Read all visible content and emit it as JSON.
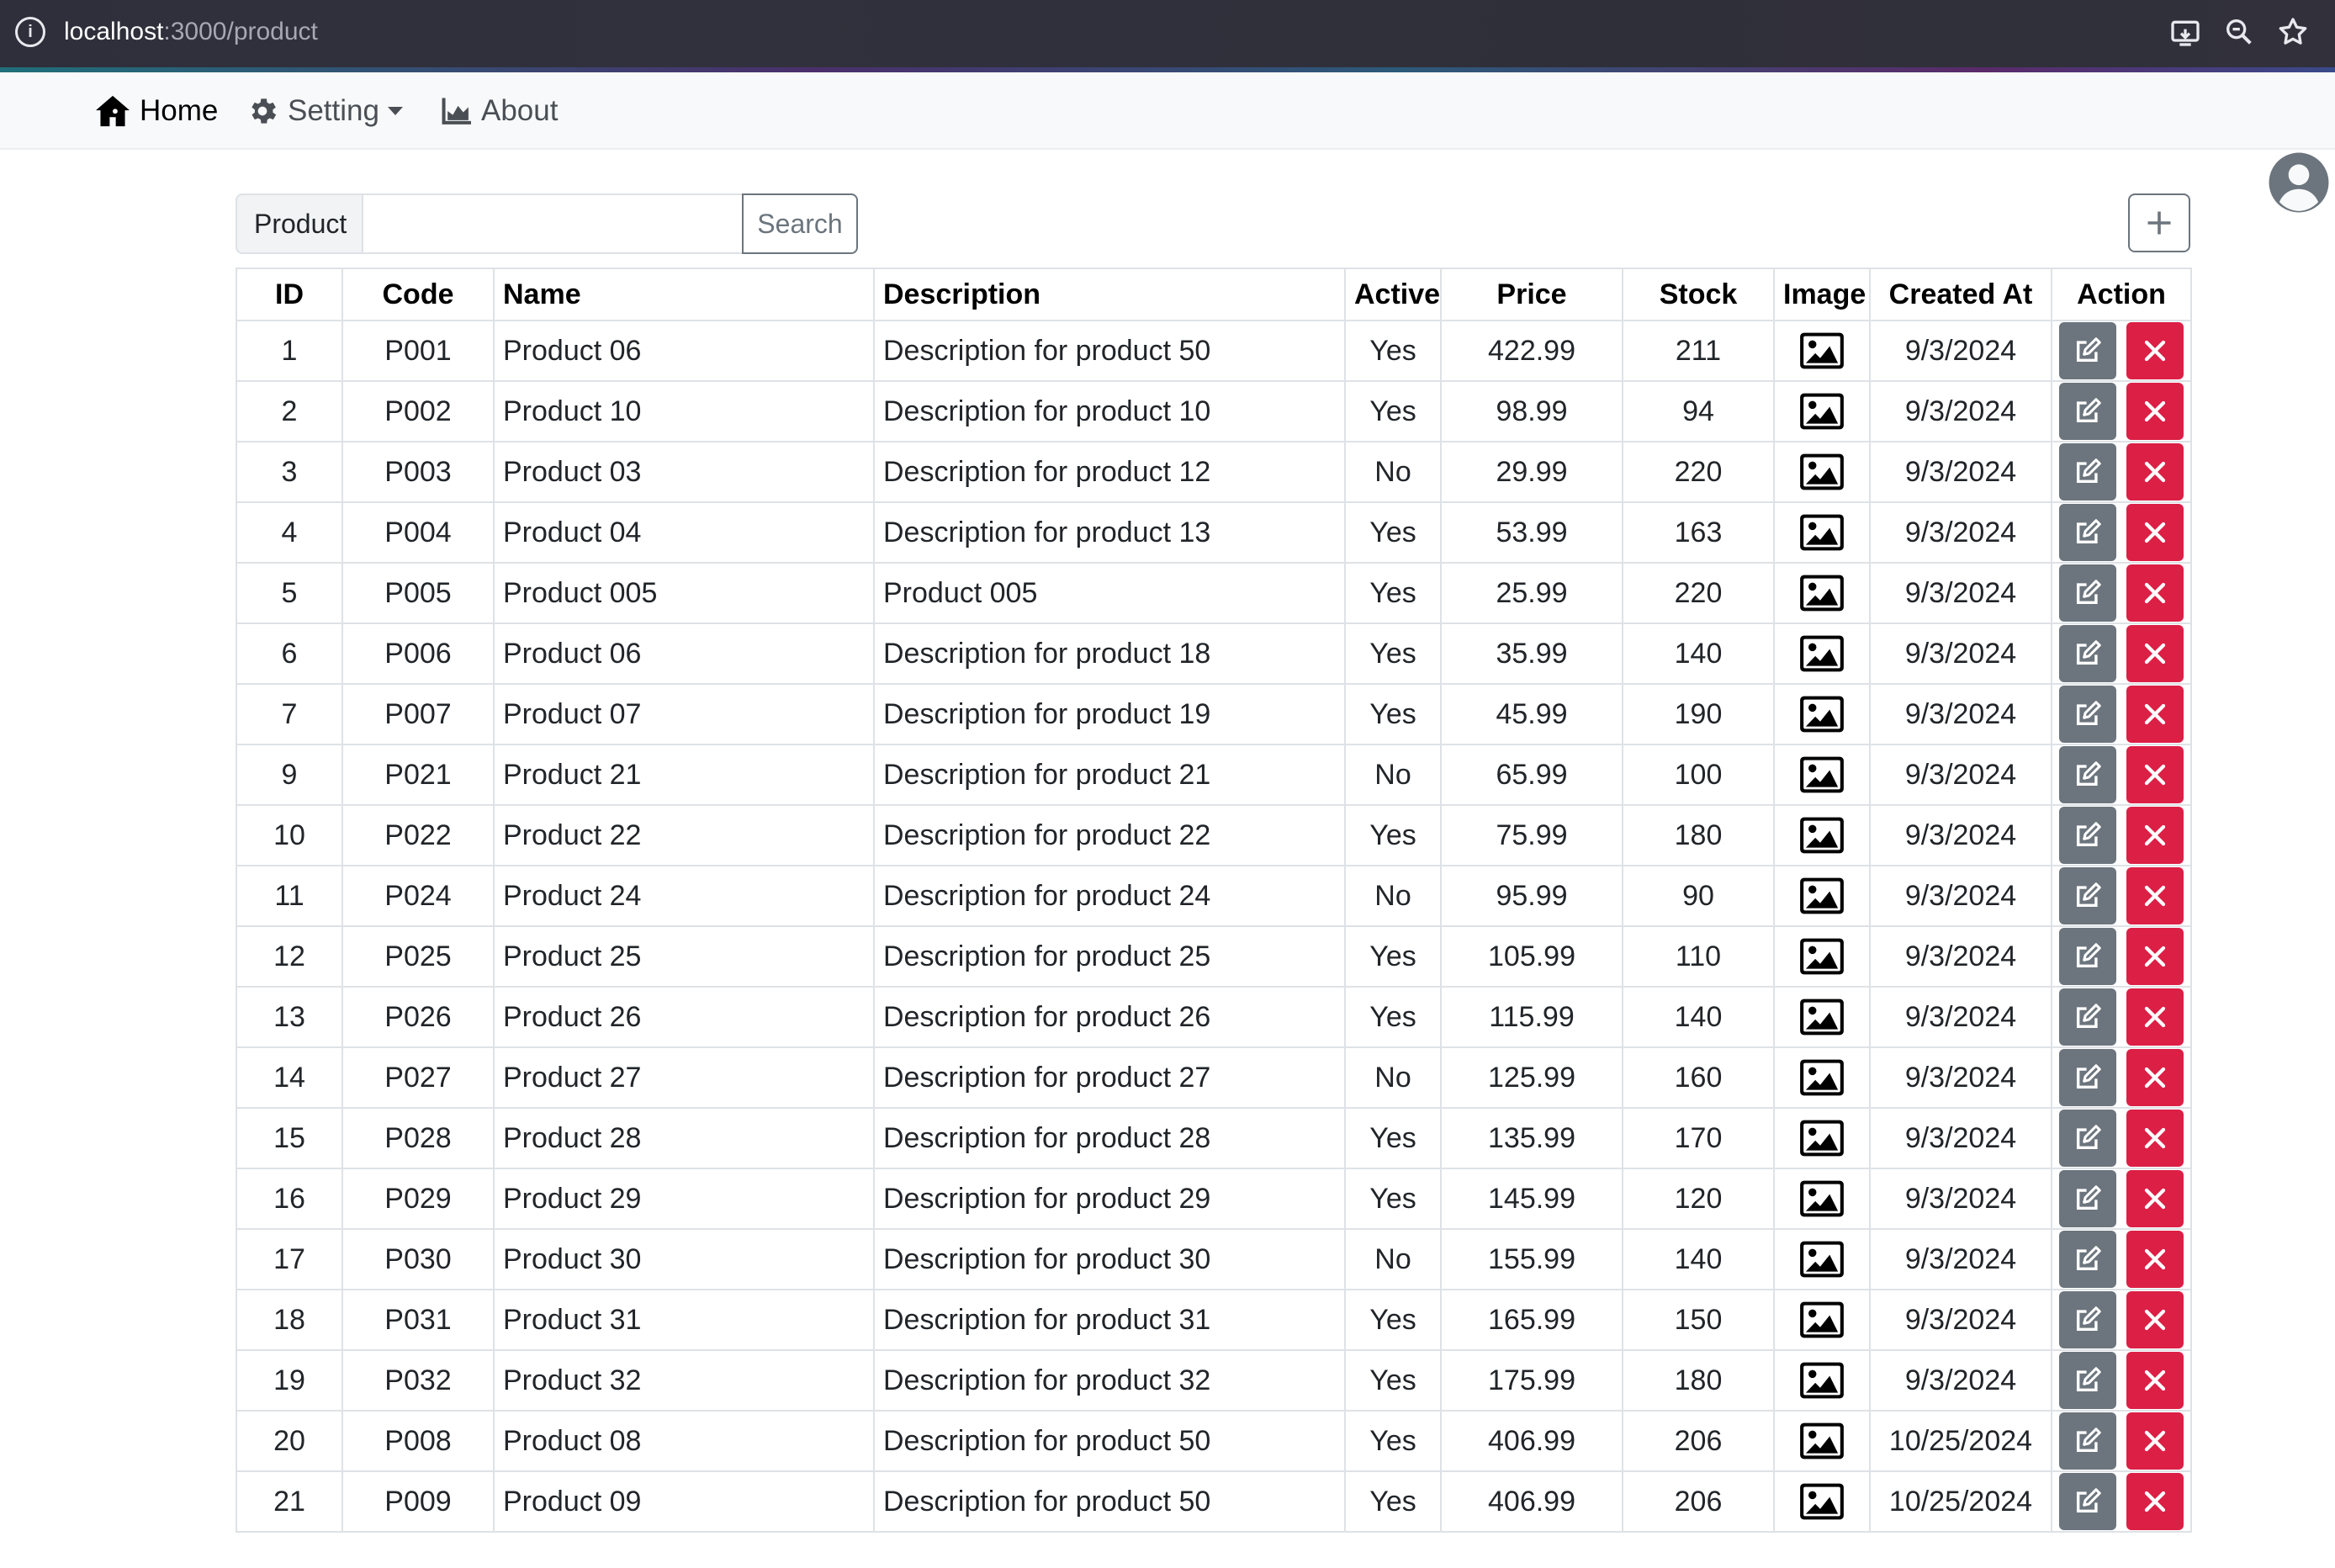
{
  "browser": {
    "url_host": "localhost",
    "url_path": ":3000/product"
  },
  "navbar": {
    "home_label": "Home",
    "setting_label": "Setting",
    "about_label": "About"
  },
  "search": {
    "label": "Product",
    "value": "",
    "button_label": "Search"
  },
  "table": {
    "headers": {
      "id": "ID",
      "code": "Code",
      "name": "Name",
      "description": "Description",
      "active": "Active",
      "price": "Price",
      "stock": "Stock",
      "image": "Image",
      "created_at": "Created At",
      "action": "Action"
    },
    "rows": [
      {
        "id": "1",
        "code": "P001",
        "name": "Product 06",
        "description": "Description for product 50",
        "active": "Yes",
        "price": "422.99",
        "stock": "211",
        "created_at": "9/3/2024"
      },
      {
        "id": "2",
        "code": "P002",
        "name": "Product 10",
        "description": "Description for product 10",
        "active": "Yes",
        "price": "98.99",
        "stock": "94",
        "created_at": "9/3/2024"
      },
      {
        "id": "3",
        "code": "P003",
        "name": "Product 03",
        "description": "Description for product 12",
        "active": "No",
        "price": "29.99",
        "stock": "220",
        "created_at": "9/3/2024"
      },
      {
        "id": "4",
        "code": "P004",
        "name": "Product 04",
        "description": "Description for product 13",
        "active": "Yes",
        "price": "53.99",
        "stock": "163",
        "created_at": "9/3/2024"
      },
      {
        "id": "5",
        "code": "P005",
        "name": "Product 005",
        "description": "Product 005",
        "active": "Yes",
        "price": "25.99",
        "stock": "220",
        "created_at": "9/3/2024"
      },
      {
        "id": "6",
        "code": "P006",
        "name": "Product 06",
        "description": "Description for product 18",
        "active": "Yes",
        "price": "35.99",
        "stock": "140",
        "created_at": "9/3/2024"
      },
      {
        "id": "7",
        "code": "P007",
        "name": "Product 07",
        "description": "Description for product 19",
        "active": "Yes",
        "price": "45.99",
        "stock": "190",
        "created_at": "9/3/2024"
      },
      {
        "id": "9",
        "code": "P021",
        "name": "Product 21",
        "description": "Description for product 21",
        "active": "No",
        "price": "65.99",
        "stock": "100",
        "created_at": "9/3/2024"
      },
      {
        "id": "10",
        "code": "P022",
        "name": "Product 22",
        "description": "Description for product 22",
        "active": "Yes",
        "price": "75.99",
        "stock": "180",
        "created_at": "9/3/2024"
      },
      {
        "id": "11",
        "code": "P024",
        "name": "Product 24",
        "description": "Description for product 24",
        "active": "No",
        "price": "95.99",
        "stock": "90",
        "created_at": "9/3/2024"
      },
      {
        "id": "12",
        "code": "P025",
        "name": "Product 25",
        "description": "Description for product 25",
        "active": "Yes",
        "price": "105.99",
        "stock": "110",
        "created_at": "9/3/2024"
      },
      {
        "id": "13",
        "code": "P026",
        "name": "Product 26",
        "description": "Description for product 26",
        "active": "Yes",
        "price": "115.99",
        "stock": "140",
        "created_at": "9/3/2024"
      },
      {
        "id": "14",
        "code": "P027",
        "name": "Product 27",
        "description": "Description for product 27",
        "active": "No",
        "price": "125.99",
        "stock": "160",
        "created_at": "9/3/2024"
      },
      {
        "id": "15",
        "code": "P028",
        "name": "Product 28",
        "description": "Description for product 28",
        "active": "Yes",
        "price": "135.99",
        "stock": "170",
        "created_at": "9/3/2024"
      },
      {
        "id": "16",
        "code": "P029",
        "name": "Product 29",
        "description": "Description for product 29",
        "active": "Yes",
        "price": "145.99",
        "stock": "120",
        "created_at": "9/3/2024"
      },
      {
        "id": "17",
        "code": "P030",
        "name": "Product 30",
        "description": "Description for product 30",
        "active": "No",
        "price": "155.99",
        "stock": "140",
        "created_at": "9/3/2024"
      },
      {
        "id": "18",
        "code": "P031",
        "name": "Product 31",
        "description": "Description for product 31",
        "active": "Yes",
        "price": "165.99",
        "stock": "150",
        "created_at": "9/3/2024"
      },
      {
        "id": "19",
        "code": "P032",
        "name": "Product 32",
        "description": "Description for product 32",
        "active": "Yes",
        "price": "175.99",
        "stock": "180",
        "created_at": "9/3/2024"
      },
      {
        "id": "20",
        "code": "P008",
        "name": "Product 08",
        "description": "Description for product 50",
        "active": "Yes",
        "price": "406.99",
        "stock": "206",
        "created_at": "10/25/2024"
      },
      {
        "id": "21",
        "code": "P009",
        "name": "Product 09",
        "description": "Description for product 50",
        "active": "Yes",
        "price": "406.99",
        "stock": "206",
        "created_at": "10/25/2024"
      }
    ]
  },
  "icons": {
    "site_info": "info-icon",
    "cast": "cast-icon",
    "zoom": "zoom-icon",
    "bookmark": "star-icon",
    "home": "home-icon",
    "setting": "gear-icon",
    "about": "chart-area-icon",
    "avatar": "user-circle-icon",
    "add": "plus-icon",
    "image": "image-icon",
    "edit": "edit-icon",
    "delete": "close-icon"
  },
  "colors": {
    "edit_button": "#6c757d",
    "delete_button": "#dc1f45",
    "navbar_bg": "#f8f9fa"
  }
}
